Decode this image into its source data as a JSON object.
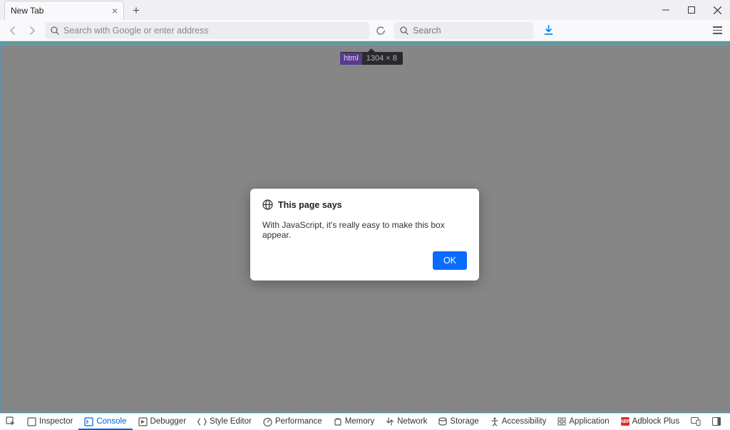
{
  "tab": {
    "title": "New Tab"
  },
  "urlbar": {
    "placeholder": "Search with Google or enter address"
  },
  "searchbar": {
    "placeholder": "Search"
  },
  "tooltip": {
    "tag": "html",
    "dims": "1304 × 8"
  },
  "dialog": {
    "title": "This page says",
    "message": "With JavaScript, it's really easy to make this box appear.",
    "ok": "OK"
  },
  "devtools": {
    "inspector": "Inspector",
    "console": "Console",
    "debugger": "Debugger",
    "style": "Style Editor",
    "perf": "Performance",
    "memory": "Memory",
    "network": "Network",
    "storage": "Storage",
    "a11y": "Accessibility",
    "app": "Application",
    "abp": "Adblock Plus"
  }
}
